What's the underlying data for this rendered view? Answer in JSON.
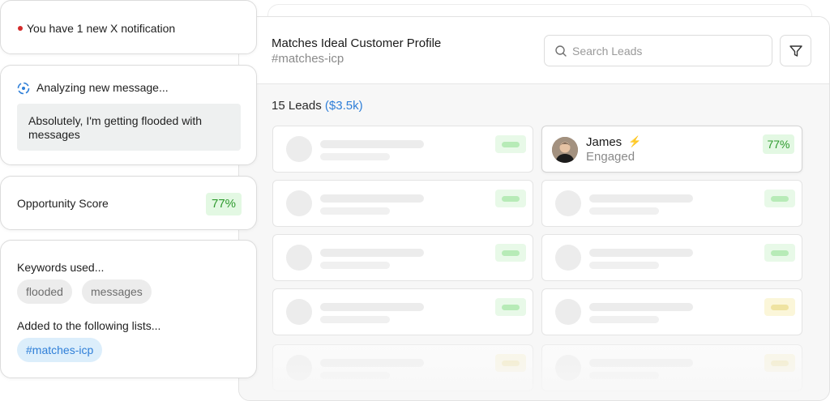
{
  "notification": {
    "text": "You have 1 new X notification"
  },
  "analysis": {
    "title": "Analyzing new message...",
    "message": "Absolutely, I'm getting flooded with messages"
  },
  "opportunity": {
    "label": "Opportunity Score",
    "score": "77%"
  },
  "keywords": {
    "label": "Keywords used...",
    "items": [
      "flooded",
      "messages"
    ],
    "lists_label": "Added to the following lists...",
    "lists": [
      "#matches-icp"
    ]
  },
  "panel": {
    "title": "Matches Ideal Customer Profile",
    "subtitle": "#matches-icp",
    "search_placeholder": "Search Leads",
    "leads_count": "15 Leads",
    "leads_value": "($3.5k)"
  },
  "lead": {
    "name": "James",
    "status": "Engaged",
    "score": "77%"
  },
  "colors": {
    "accent_blue": "#2f7fd8",
    "score_green": "#2e9a2e",
    "notification_red": "#d32b2b",
    "bolt_yellow": "#f2b632"
  },
  "icons": [
    "red-dot-icon",
    "spinner-icon",
    "search-icon",
    "filter-icon",
    "bolt-icon"
  ]
}
